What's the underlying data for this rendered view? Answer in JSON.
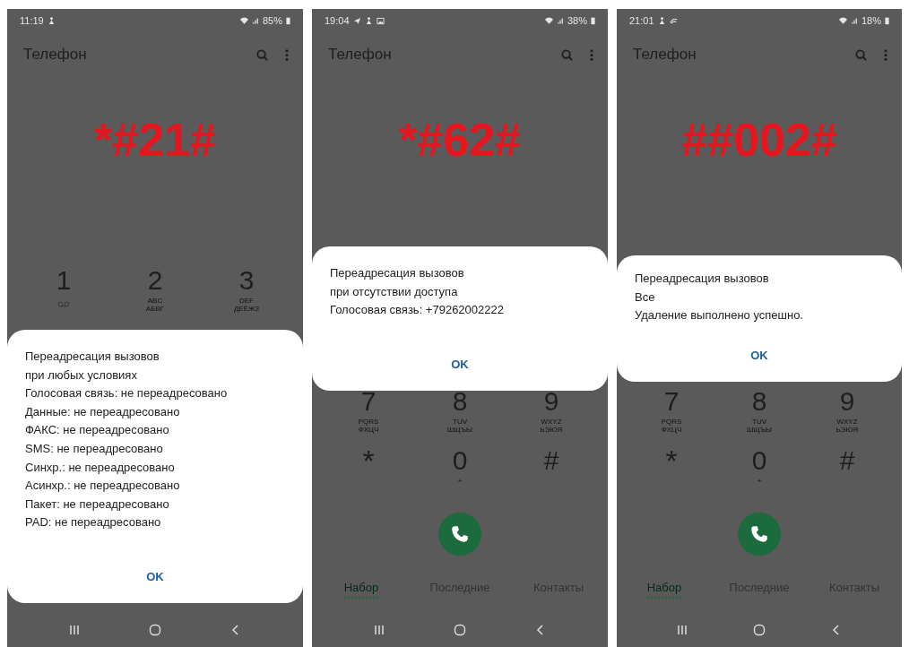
{
  "phones": [
    {
      "status_bar": {
        "time": "11:19",
        "battery": "85%"
      },
      "title": "Телефон",
      "code": "*#21#",
      "keys": [
        {
          "digit": "1",
          "kind": "voicemail"
        },
        {
          "digit": "2",
          "kind": "letters",
          "letters": [
            "ABC",
            "АБВГ"
          ]
        },
        {
          "digit": "3",
          "kind": "letters",
          "letters": [
            "DEF",
            "ДЕЁЖЗ"
          ]
        }
      ],
      "call_button": false,
      "dialog": {
        "lines": [
          "Переадресация вызовов",
          "при любых условиях",
          "Голосовая связь: не переадресовано",
          "Данные: не переадресовано",
          "ФАКС: не переадресовано",
          "SMS: не переадресовано",
          "Синхр.: не переадресовано",
          "Асинхр.: не переадресовано",
          "Пакет: не переадресовано",
          "PAD: не переадресовано"
        ],
        "button": "OK"
      }
    },
    {
      "status_bar": {
        "time": "19:04",
        "battery": "38%"
      },
      "title": "Телефон",
      "code": "*#62#",
      "keys": [
        {
          "digit": "7",
          "kind": "letters",
          "letters": [
            "PQRS",
            "ФХЦЧ"
          ]
        },
        {
          "digit": "8",
          "kind": "letters",
          "letters": [
            "TUV",
            "ШЩЪЫ"
          ]
        },
        {
          "digit": "9",
          "kind": "letters",
          "letters": [
            "WXYZ",
            "ЬЭЮЯ"
          ]
        },
        {
          "digit": "*",
          "kind": "star"
        },
        {
          "digit": "0",
          "kind": "letters",
          "letters": [
            "+"
          ]
        },
        {
          "digit": "#",
          "kind": "plain"
        }
      ],
      "call_button": true,
      "tabs": [
        {
          "label": "Набор",
          "selected": true
        },
        {
          "label": "Последние",
          "selected": false
        },
        {
          "label": "Контакты",
          "selected": false
        }
      ],
      "dialog": {
        "lines": [
          "Переадресация вызовов",
          "при отсутствии доступа",
          "Голосовая связь: +79262002222"
        ],
        "button": "OK"
      }
    },
    {
      "status_bar": {
        "time": "21:01",
        "battery": "18%"
      },
      "title": "Телефон",
      "code": "##002#",
      "keys": [
        {
          "digit": "7",
          "kind": "letters",
          "letters": [
            "PQRS",
            "ФХЦЧ"
          ]
        },
        {
          "digit": "8",
          "kind": "letters",
          "letters": [
            "TUV",
            "ШЩЪЫ"
          ]
        },
        {
          "digit": "9",
          "kind": "letters",
          "letters": [
            "WXYZ",
            "ЬЭЮЯ"
          ]
        },
        {
          "digit": "*",
          "kind": "star"
        },
        {
          "digit": "0",
          "kind": "letters",
          "letters": [
            "+"
          ]
        },
        {
          "digit": "#",
          "kind": "plain"
        }
      ],
      "call_button": true,
      "tabs": [
        {
          "label": "Набор",
          "selected": true
        },
        {
          "label": "Последние",
          "selected": false
        },
        {
          "label": "Контакты",
          "selected": false
        }
      ],
      "dialog": {
        "lines": [
          "Переадресация вызовов",
          "Все",
          "Удаление выполнено успешно."
        ],
        "button": "OK"
      }
    }
  ]
}
